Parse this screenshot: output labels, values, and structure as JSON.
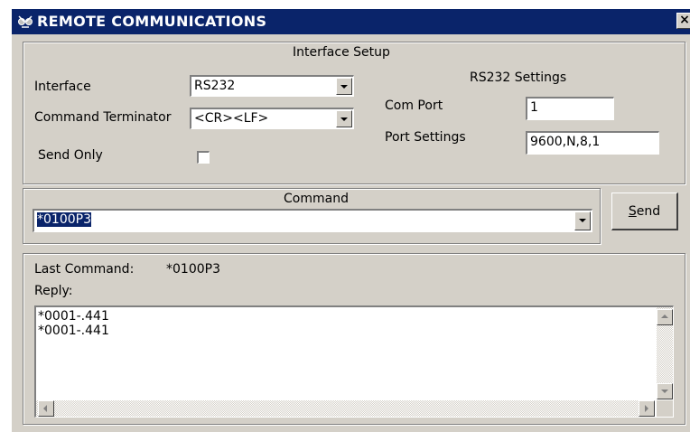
{
  "window": {
    "title": "REMOTE COMMUNICATIONS",
    "close_label": "×"
  },
  "interface_setup": {
    "group_title": "Interface Setup",
    "interface_label": "Interface",
    "interface_value": "RS232",
    "terminator_label": "Command Terminator",
    "terminator_value": "<CR><LF>",
    "send_only_label": "Send Only",
    "send_only_checked": false
  },
  "rs232_settings": {
    "title": "RS232 Settings",
    "com_port_label": "Com Port",
    "com_port_value": "1",
    "port_settings_label": "Port Settings",
    "port_settings_value": "9600,N,8,1"
  },
  "command": {
    "group_title": "Command",
    "value": "*0100P3",
    "send_label_prefix": "",
    "send_label_mnemonic": "S",
    "send_label_rest": "end"
  },
  "reply": {
    "last_command_label": "Last Command:",
    "last_command_value": "*0100P3",
    "reply_label": "Reply:",
    "lines": [
      "*0001-.441",
      "*0001-.441"
    ]
  }
}
